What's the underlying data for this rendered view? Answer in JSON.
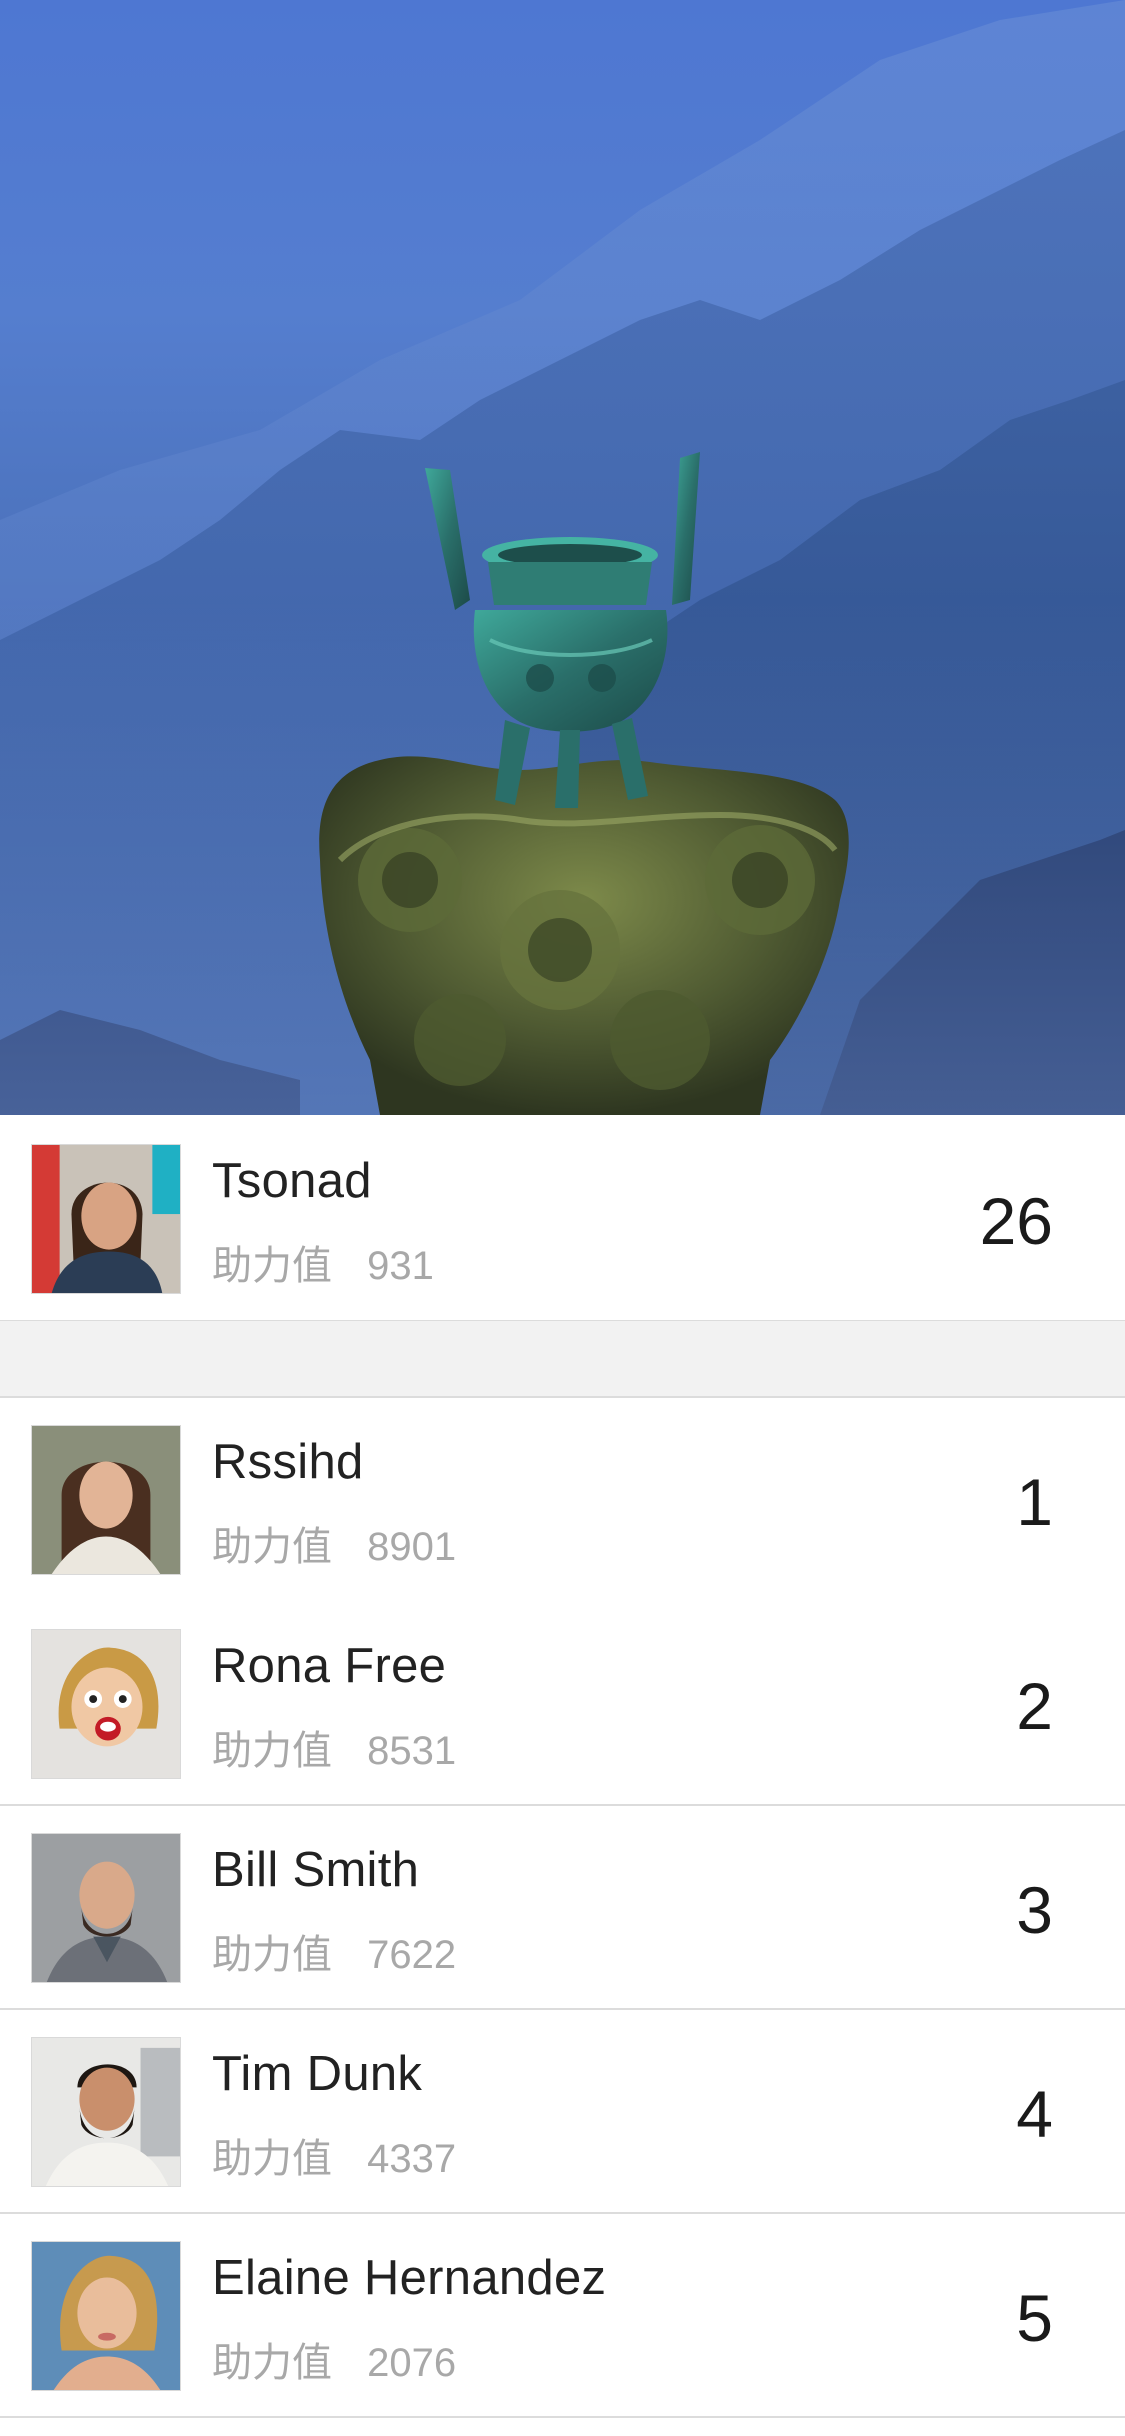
{
  "hero": {
    "image": "mountain-bronze-vessel-image"
  },
  "current_user": {
    "name": "Tsonad",
    "points_label": "助力值",
    "points": "931",
    "rank": "26"
  },
  "leaderboard": [
    {
      "name": "Rssihd",
      "points_label": "助力值",
      "points": "8901",
      "rank": "1"
    },
    {
      "name": "Rona Free",
      "points_label": "助力值",
      "points": "8531",
      "rank": "2"
    },
    {
      "name": "Bill Smith",
      "points_label": "助力值",
      "points": "7622",
      "rank": "3"
    },
    {
      "name": "Tim Dunk",
      "points_label": "助力值",
      "points": "4337",
      "rank": "4"
    },
    {
      "name": "Elaine Hernandez",
      "points_label": "助力值",
      "points": "2076",
      "rank": "5"
    }
  ],
  "colors": {
    "name_text": "#222222",
    "points_text": "#a8a8a8",
    "divider": "#dcdcdc",
    "section_gap": "#f2f2f2"
  }
}
